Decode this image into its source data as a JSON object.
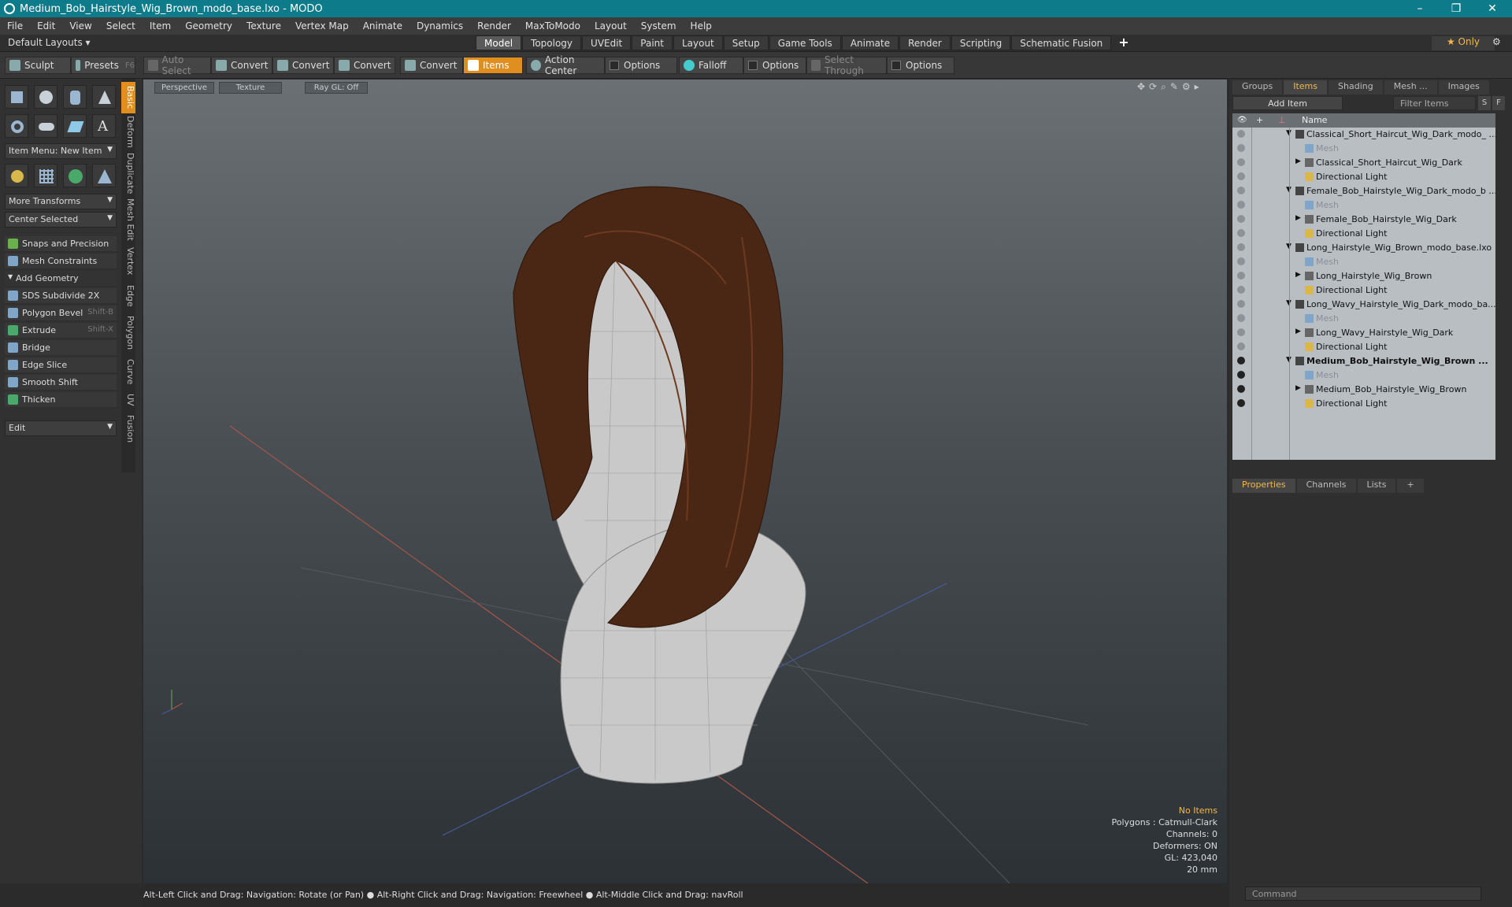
{
  "window": {
    "title": "Medium_Bob_Hairstyle_Wig_Brown_modo_base.lxo - MODO",
    "controls": [
      "–",
      "❐",
      "✕"
    ]
  },
  "menu": [
    "File",
    "Edit",
    "View",
    "Select",
    "Item",
    "Geometry",
    "Texture",
    "Vertex Map",
    "Animate",
    "Dynamics",
    "Render",
    "MaxToModo",
    "Layout",
    "System",
    "Help"
  ],
  "layout": {
    "default_label": "Default Layouts ▾",
    "tabs": [
      "Model",
      "Topology",
      "UVEdit",
      "Paint",
      "Layout",
      "Setup",
      "Game Tools",
      "Animate",
      "Render",
      "Scripting",
      "Schematic Fusion"
    ],
    "active_tab": "Model",
    "plus": "+",
    "only": "★ Only",
    "gear": "⚙"
  },
  "toolbar": {
    "sculpt": "Sculpt",
    "presets": "Presets",
    "presets_key": "F6",
    "auto_select": "Auto Select",
    "convert1": "Convert",
    "convert2": "Convert",
    "convert3": "Convert",
    "convert4": "Convert",
    "items": "Items",
    "action_center": "Action Center",
    "options1": "Options",
    "falloff": "Falloff",
    "options2": "Options",
    "select_through": "Select Through",
    "options3": "Options"
  },
  "left": {
    "vtabs": [
      "Basic",
      "Deform",
      "Duplicate",
      "Mesh Edit",
      "Vertex",
      "Edge",
      "Polygon",
      "Curve",
      "UV",
      "Fusion"
    ],
    "item_menu": "Item Menu: New Item",
    "more_transforms": "More Transforms",
    "center_selected": "Center Selected",
    "snaps": "Snaps and Precision",
    "mesh_constraints": "Mesh Constraints",
    "add_geometry": "Add Geometry",
    "tools": [
      {
        "label": "SDS Subdivide 2X",
        "key": ""
      },
      {
        "label": "Polygon Bevel",
        "key": "Shift-B"
      },
      {
        "label": "Extrude",
        "key": "Shift-X"
      },
      {
        "label": "Bridge",
        "key": ""
      },
      {
        "label": "Edge Slice",
        "key": ""
      },
      {
        "label": "Smooth Shift",
        "key": ""
      },
      {
        "label": "Thicken",
        "key": ""
      }
    ],
    "edit": "Edit"
  },
  "viewport": {
    "perspective": "Perspective",
    "texture": "Texture",
    "raygl": "Ray GL: Off",
    "stats": {
      "no_items": "No Items",
      "polygons": "Polygons : Catmull-Clark",
      "channels": "Channels: 0",
      "deformers": "Deformers: ON",
      "gl": "GL: 423,040",
      "scale": "20 mm"
    }
  },
  "status": "Alt-Left Click and Drag: Navigation: Rotate (or Pan) ● Alt-Right Click and Drag: Navigation: Freewheel ● Alt-Middle Click and Drag: navRoll",
  "right": {
    "tabs": [
      "Groups",
      "Items",
      "Shading",
      "Mesh ...",
      "Images"
    ],
    "active": "Items",
    "add_item": "Add Item",
    "filter": "Filter Items",
    "s": "S",
    "f": "F",
    "name_col": "Name",
    "rows": [
      {
        "label": "Classical_Short_Haircut_Wig_Dark_modo_ ...",
        "level": 0,
        "type": "scene",
        "eye": false
      },
      {
        "label": "Mesh",
        "level": 1,
        "type": "mesh",
        "eye": false
      },
      {
        "label": "Classical_Short_Haircut_Wig_Dark",
        "level": 1,
        "type": "group",
        "eye": false
      },
      {
        "label": "Directional Light",
        "level": 1,
        "type": "light",
        "eye": false
      },
      {
        "label": "Female_Bob_Hairstyle_Wig_Dark_modo_b ...",
        "level": 0,
        "type": "scene",
        "eye": false
      },
      {
        "label": "Mesh",
        "level": 1,
        "type": "mesh",
        "eye": false
      },
      {
        "label": "Female_Bob_Hairstyle_Wig_Dark",
        "level": 1,
        "type": "group",
        "eye": false
      },
      {
        "label": "Directional Light",
        "level": 1,
        "type": "light",
        "eye": false
      },
      {
        "label": "Long_Hairstyle_Wig_Brown_modo_base.lxo",
        "level": 0,
        "type": "scene",
        "eye": false
      },
      {
        "label": "Mesh",
        "level": 1,
        "type": "mesh",
        "eye": false
      },
      {
        "label": "Long_Hairstyle_Wig_Brown",
        "level": 1,
        "type": "group",
        "eye": false
      },
      {
        "label": "Directional Light",
        "level": 1,
        "type": "light",
        "eye": false
      },
      {
        "label": "Long_Wavy_Hairstyle_Wig_Dark_modo_ba...",
        "level": 0,
        "type": "scene",
        "eye": false
      },
      {
        "label": "Mesh",
        "level": 1,
        "type": "mesh",
        "eye": false
      },
      {
        "label": "Long_Wavy_Hairstyle_Wig_Dark",
        "level": 1,
        "type": "group",
        "eye": false
      },
      {
        "label": "Directional Light",
        "level": 1,
        "type": "light",
        "eye": false
      },
      {
        "label": "Medium_Bob_Hairstyle_Wig_Brown ...",
        "level": 0,
        "type": "scene",
        "eye": true,
        "bold": true
      },
      {
        "label": "Mesh",
        "level": 1,
        "type": "mesh",
        "eye": true
      },
      {
        "label": "Medium_Bob_Hairstyle_Wig_Brown",
        "level": 1,
        "type": "group",
        "eye": true
      },
      {
        "label": "Directional Light",
        "level": 1,
        "type": "light",
        "eye": true
      }
    ],
    "prop_tabs": [
      "Properties",
      "Channels",
      "Lists",
      "+"
    ],
    "command": "Command"
  }
}
